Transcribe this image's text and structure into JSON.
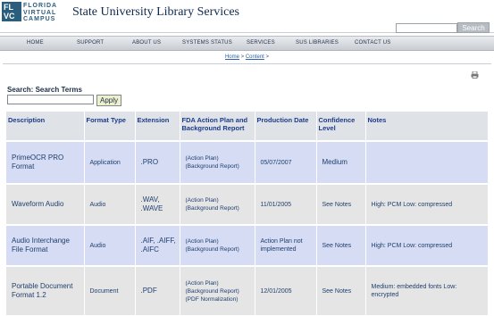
{
  "header": {
    "logo_lines": [
      "FL",
      "VC"
    ],
    "logo_words": [
      "FLORIDA",
      "VIRTUAL",
      "CAMPUS"
    ],
    "site_title": "State University Library Services",
    "search_button": "Search"
  },
  "nav": {
    "items": [
      "HOME",
      "SUPPORT",
      "ABOUT US",
      "SYSTEMS STATUS",
      "SERVICES",
      "SUS LIBRARIES",
      "CONTACT US"
    ]
  },
  "breadcrumb": {
    "home": "Home",
    "sep1": " > ",
    "content": "Content",
    "sep2": " >"
  },
  "search": {
    "label": "Search: Search Terms",
    "input_value": "",
    "apply_label": "Apply"
  },
  "table": {
    "headers": [
      "Description",
      "Format Type",
      "Extension",
      "FDA Action Plan and Background Report",
      "Production Date",
      "Confidence Level",
      "Notes"
    ],
    "rows": [
      {
        "description": "PrimeOCR PRO Format",
        "format_type": "Application",
        "extension": ".PRO",
        "fda": [
          "(Action Plan)",
          "(Background Report)"
        ],
        "production_date": "05/07/2007",
        "confidence": "Medium",
        "notes": ""
      },
      {
        "description": "Waveform Audio",
        "format_type": "Audio",
        "extension": ".WAV, .WAVE",
        "fda": [
          "(Action Plan)",
          "(Background Report)"
        ],
        "production_date": "11/01/2005",
        "confidence": "See Notes",
        "notes": "High: PCM Low: compressed"
      },
      {
        "description": "Audio Interchange File Format",
        "format_type": "Audio",
        "extension": ".AIF, .AIFF, .AIFC",
        "fda": [
          "(Action Plan)",
          "(Background Report)"
        ],
        "production_date": "Action Plan not implemented",
        "confidence": "See Notes",
        "notes": "High: PCM Low: compressed"
      },
      {
        "description": "Portable Document Format 1.2",
        "format_type": "Document",
        "extension": ".PDF",
        "fda": [
          "(Action Plan)",
          "(Background Report)",
          "(PDF Normalization)"
        ],
        "production_date": "12/01/2005",
        "confidence": "See Notes",
        "notes": "Medium: embedded fonts Low: encrypted"
      }
    ]
  },
  "icons": {
    "print": "printer-icon"
  },
  "colors": {
    "brand": "#2b5d7d",
    "row_blue": "#d5dcf4",
    "row_gray": "#e5e5e5",
    "header_bg": "#dfe3e8"
  }
}
